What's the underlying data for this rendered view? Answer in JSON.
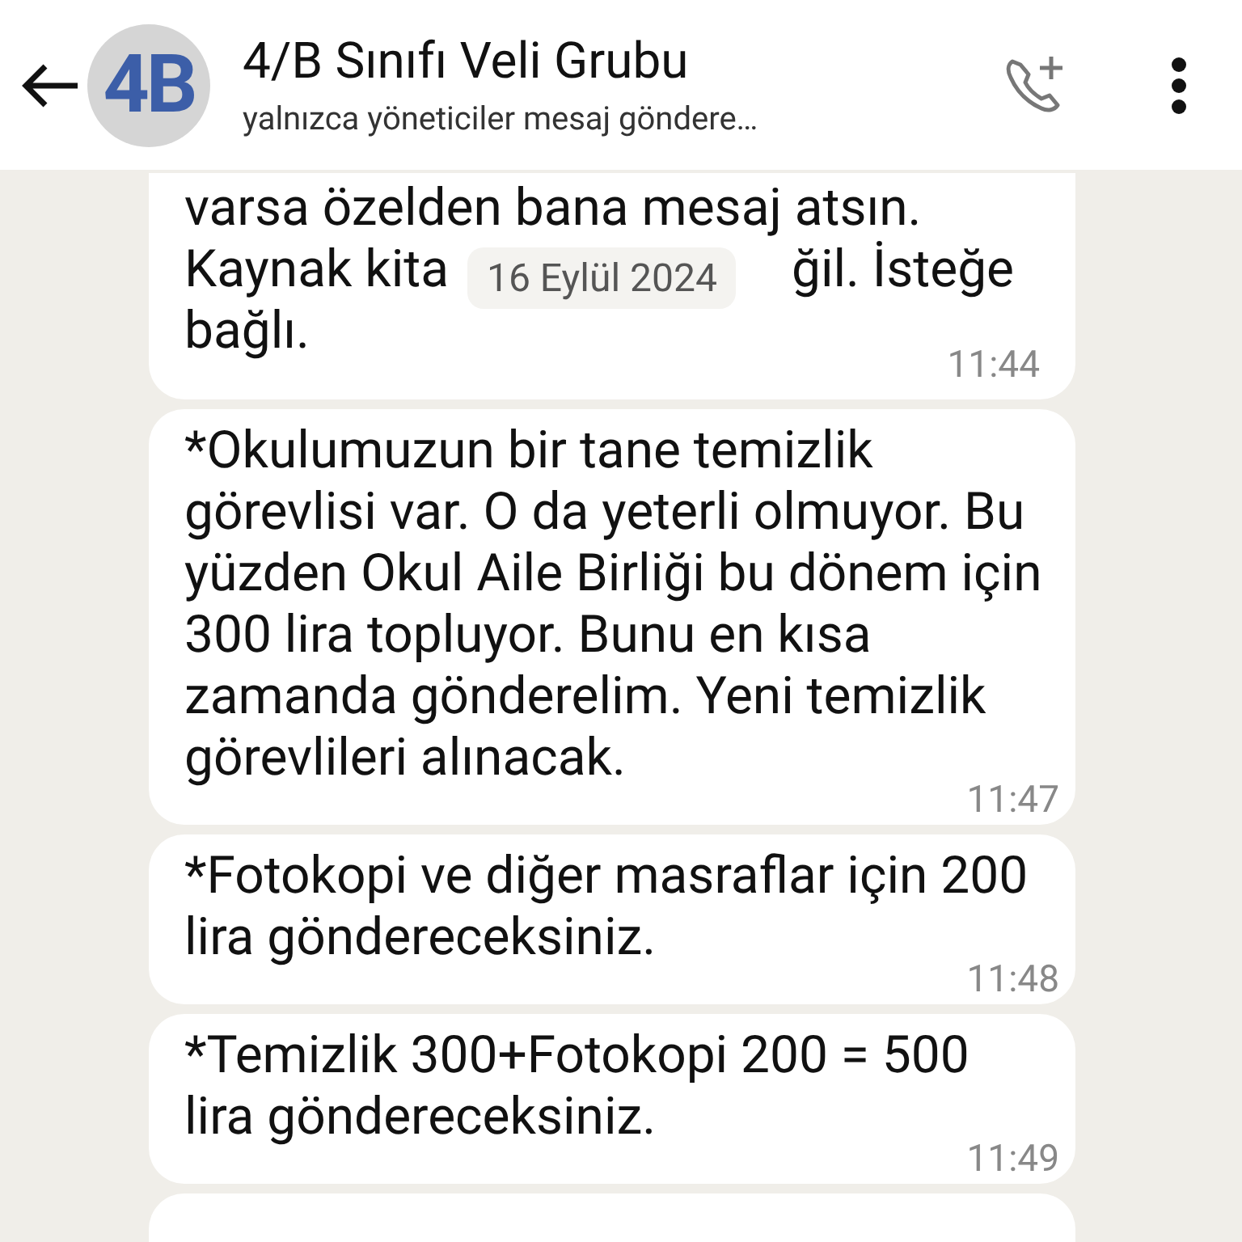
{
  "header": {
    "avatar_text": "4B",
    "title": "4/B Sınıfı Veli Grubu",
    "subtitle": "yalnızca yöneticiler mesaj göndere…"
  },
  "date_chip": "16 Eylül 2024",
  "messages": [
    {
      "kind": "fragments",
      "lines": [
        [
          "varsa özelden bana mesaj atsın."
        ],
        [
          "Kaynak kita",
          "ğil. İsteğe"
        ],
        [
          "bağlı."
        ]
      ],
      "time": "11:44"
    },
    {
      "kind": "text",
      "text": "*Okulumuzun bir tane temizlik görevlisi var. O da yeterli olmuyor. Bu yüzden Okul Aile Birliği bu dönem için 300 lira topluyor. Bunu en kısa zamanda gönderelim. Yeni temizlik görevlileri alınacak.",
      "time": "11:47"
    },
    {
      "kind": "text",
      "text": "*Fotokopi ve diğer masraflar için 200 lira göndereceksiniz.",
      "time": "11:48"
    },
    {
      "kind": "text",
      "text": "*Temizlik 300+Fotokopi 200 = 500 lira göndereceksiniz.",
      "time": "11:49"
    },
    {
      "kind": "cut"
    }
  ]
}
